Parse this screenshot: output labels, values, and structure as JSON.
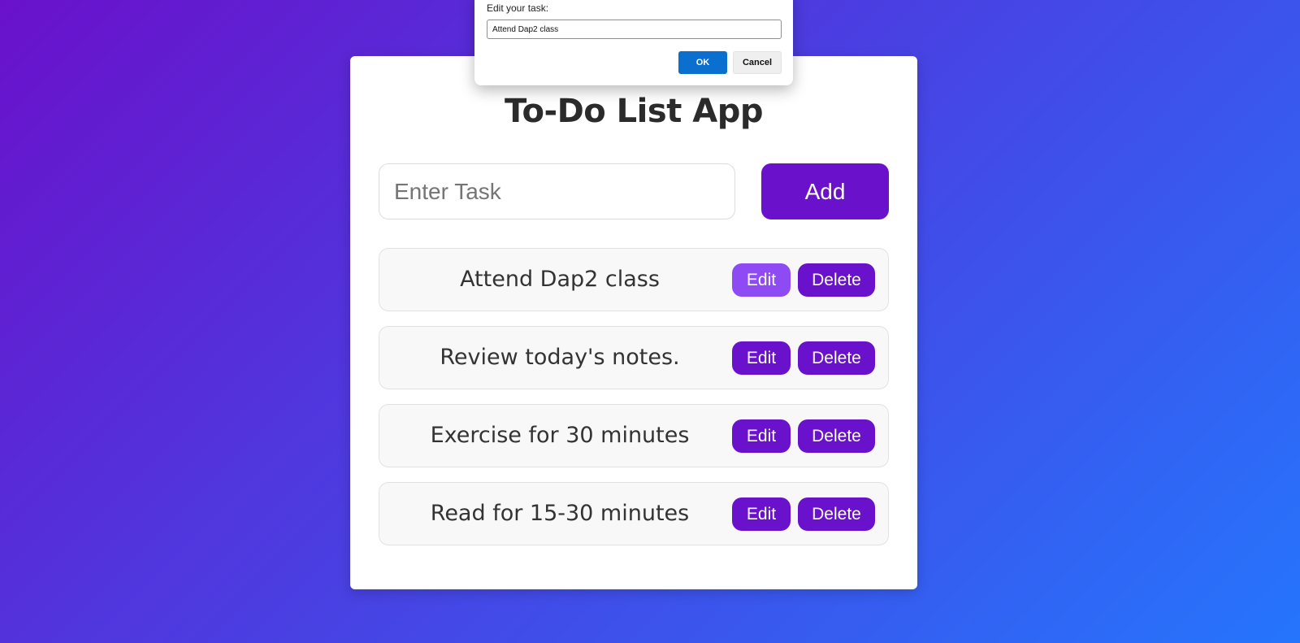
{
  "app": {
    "title": "To-Do List App",
    "input_placeholder": "Enter Task",
    "add_label": "Add"
  },
  "tasks": [
    {
      "text": "Attend Dap2 class",
      "edit_label": "Edit",
      "delete_label": "Delete"
    },
    {
      "text": "Review today's notes.",
      "edit_label": "Edit",
      "delete_label": "Delete"
    },
    {
      "text": "Exercise for 30 minutes",
      "edit_label": "Edit",
      "delete_label": "Delete"
    },
    {
      "text": "Read for 15-30 minutes",
      "edit_label": "Edit",
      "delete_label": "Delete"
    }
  ],
  "dialog": {
    "label": "Edit your task:",
    "value": "Attend Dap2 class",
    "ok_label": "OK",
    "cancel_label": "Cancel"
  },
  "colors": {
    "gradient_start": "#6a11cb",
    "gradient_end": "#2575fc",
    "button": "#6a11cb",
    "button_hover": "#8e4af3",
    "dialog_ok": "#0b6fd0"
  }
}
